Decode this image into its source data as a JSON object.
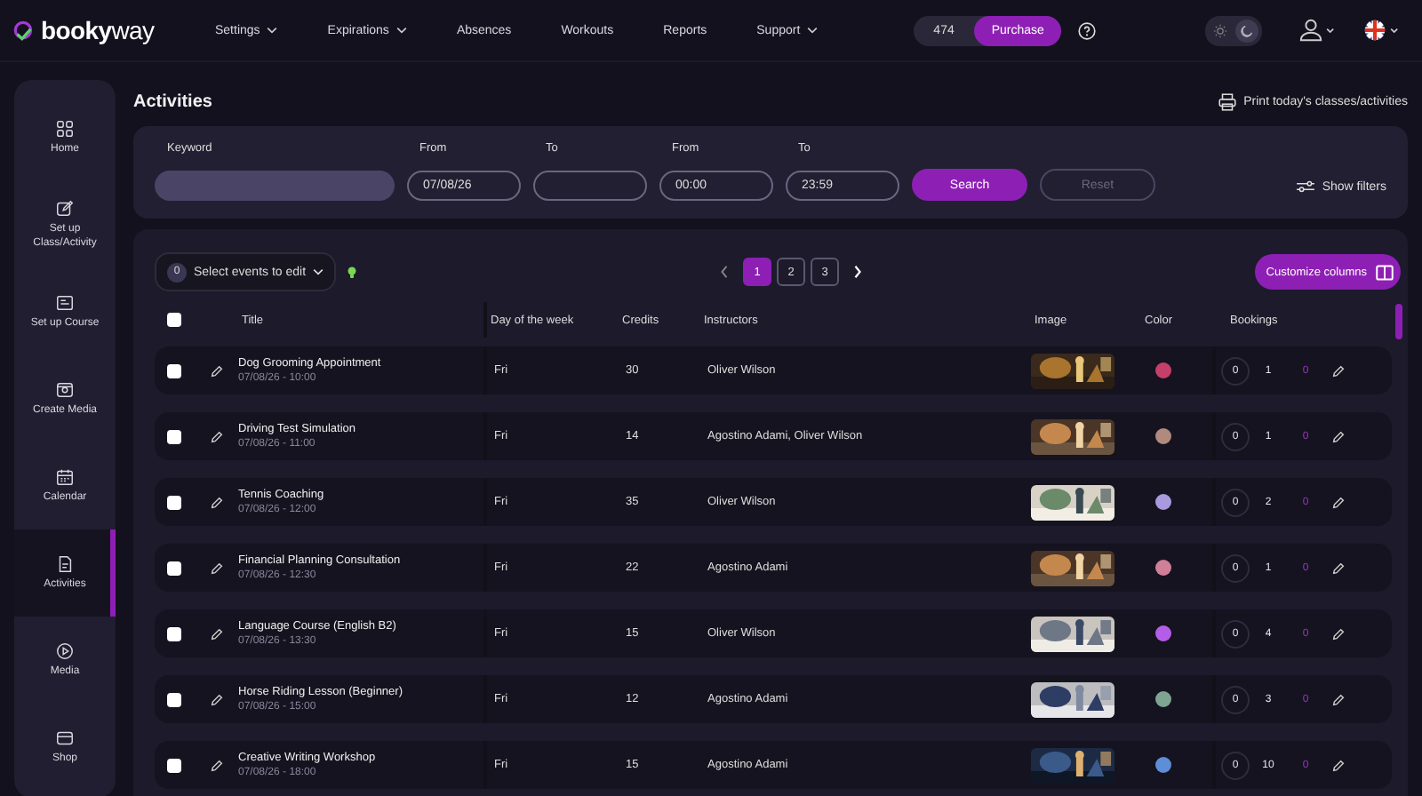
{
  "brand": {
    "name_bold": "booky",
    "name_light": "way"
  },
  "nav": [
    {
      "label": "Settings",
      "dropdown": true
    },
    {
      "label": "Expirations",
      "dropdown": true
    },
    {
      "label": "Absences",
      "dropdown": false
    },
    {
      "label": "Workouts",
      "dropdown": false
    },
    {
      "label": "Reports",
      "dropdown": false
    },
    {
      "label": "Support",
      "dropdown": true
    }
  ],
  "credits": {
    "count": "474",
    "button": "Purchase"
  },
  "theme": [
    {
      "kind": "light",
      "selected": false
    },
    {
      "kind": "dark",
      "selected": true
    }
  ],
  "sidebar": {
    "items": [
      {
        "label": "Home",
        "selected": false
      },
      {
        "label": "Set up Class/Activity",
        "selected": false
      },
      {
        "label": "Set up Course",
        "selected": false
      },
      {
        "label": "Create Media",
        "selected": false
      },
      {
        "label": "Calendar",
        "selected": false
      },
      {
        "label": "Activities",
        "selected": true
      },
      {
        "label": "Media",
        "selected": false
      },
      {
        "label": "Shop",
        "selected": false
      }
    ]
  },
  "page_title": "Activities",
  "print_link": "Print today's classes/activities",
  "filters": {
    "fields": [
      {
        "label": "Keyword",
        "kind": "text"
      },
      {
        "label": "From",
        "kind": "date",
        "value": "07/08/26"
      },
      {
        "label": "To",
        "kind": "date"
      },
      {
        "label": "From",
        "kind": "time",
        "value": "00:00"
      },
      {
        "label": "To",
        "kind": "time",
        "value": "23:59"
      }
    ],
    "search_button": "Search",
    "reset_button": {
      "label": "Reset",
      "disabled": true
    },
    "show_filters": "Show filters"
  },
  "table": {
    "selected_count": "0",
    "select_all_checked": false,
    "select_label": "Select events to edit",
    "pages": [
      {
        "label": "1",
        "selected": true
      },
      {
        "label": "2",
        "selected": false
      },
      {
        "label": "3",
        "selected": false
      }
    ],
    "customize_button": "Customize columns",
    "columns": [
      "Title",
      "Day of the week",
      "Credits",
      "Instructors",
      "Image",
      "Color",
      "Bookings"
    ],
    "rows": [
      {
        "checked": false,
        "title": "Dog Grooming Appointment",
        "when": "07/08/26 - 10:00",
        "day": "Fri",
        "credits": "30",
        "instructors": "Oliver Wilson",
        "color": "#c4406a",
        "bookings": [
          "0",
          "1",
          "0"
        ]
      },
      {
        "checked": false,
        "title": "Driving Test Simulation",
        "when": "07/08/26 - 11:00",
        "day": "Fri",
        "credits": "14",
        "instructors": "Agostino Adami, Oliver Wilson",
        "color": "#b08a7c",
        "bookings": [
          "0",
          "1",
          "0"
        ]
      },
      {
        "checked": false,
        "title": "Tennis Coaching",
        "when": "07/08/26 - 12:00",
        "day": "Fri",
        "credits": "35",
        "instructors": "Oliver Wilson",
        "color": "#a99ae0",
        "bookings": [
          "0",
          "2",
          "0"
        ]
      },
      {
        "checked": false,
        "title": "Financial Planning Consultation",
        "when": "07/08/26 - 12:30",
        "day": "Fri",
        "credits": "22",
        "instructors": "Agostino Adami",
        "color": "#d07f98",
        "bookings": [
          "0",
          "1",
          "0"
        ]
      },
      {
        "checked": false,
        "title": "Language Course (English B2)",
        "when": "07/08/26 - 13:30",
        "day": "Fri",
        "credits": "15",
        "instructors": "Oliver Wilson",
        "color": "#b45ee8",
        "bookings": [
          "0",
          "4",
          "0"
        ]
      },
      {
        "checked": false,
        "title": "Horse Riding Lesson (Beginner)",
        "when": "07/08/26 - 15:00",
        "day": "Fri",
        "credits": "12",
        "instructors": "Agostino Adami",
        "color": "#7fa592",
        "bookings": [
          "0",
          "3",
          "0"
        ]
      },
      {
        "checked": false,
        "title": "Creative Writing Workshop",
        "when": "07/08/26 - 18:00",
        "day": "Fri",
        "credits": "15",
        "instructors": "Agostino Adami",
        "color": "#5f8ed8",
        "bookings": [
          "0",
          "10",
          "0"
        ]
      }
    ]
  }
}
